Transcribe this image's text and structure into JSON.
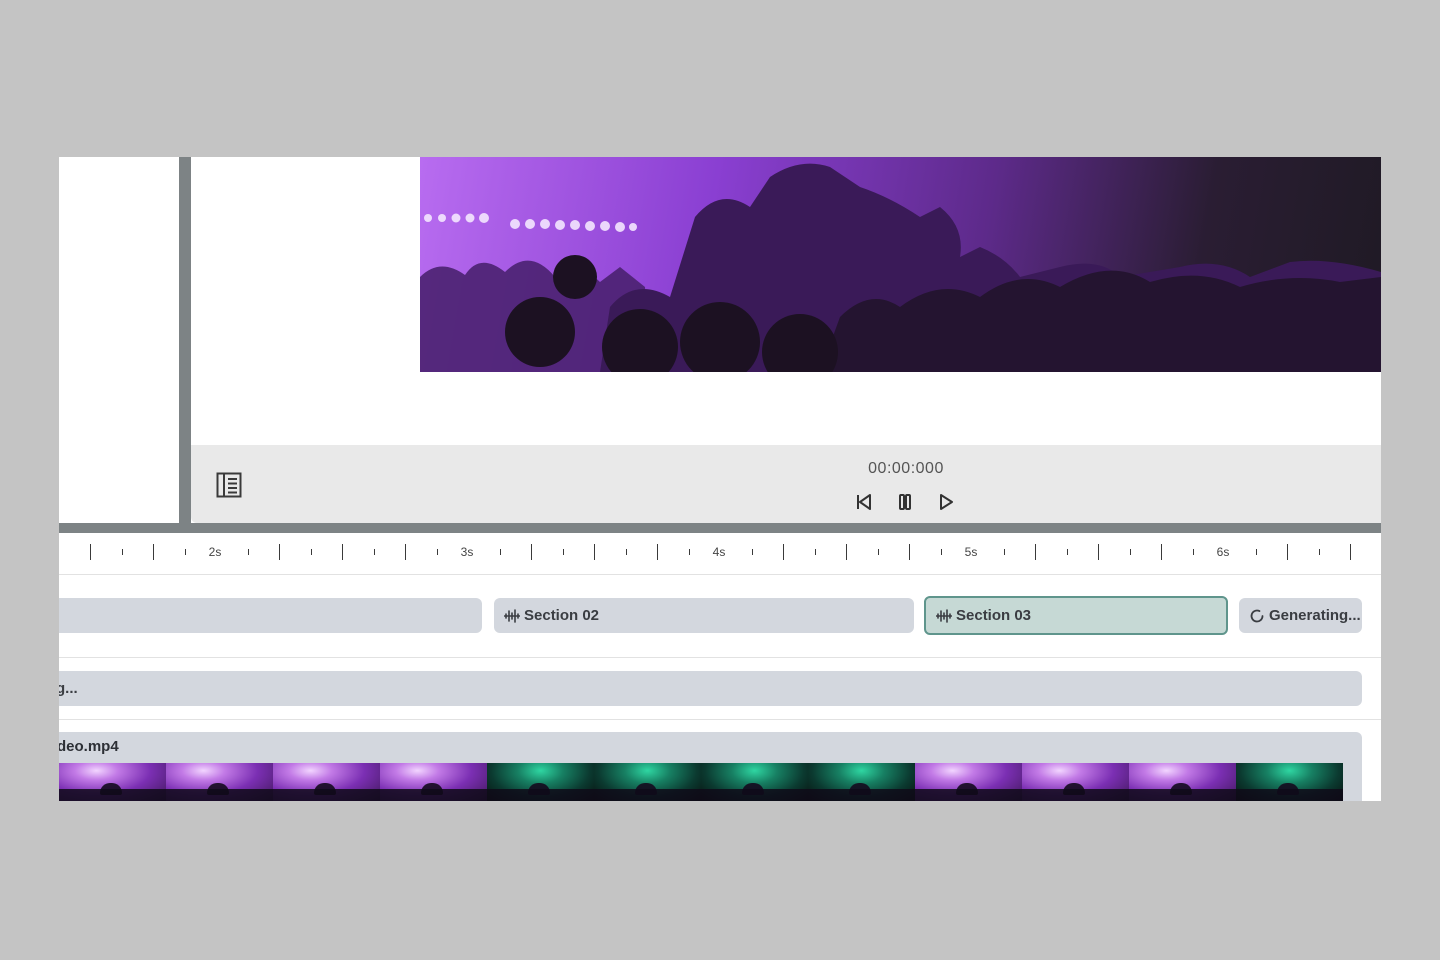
{
  "preview": {
    "timecode": "00:00:000"
  },
  "controls": {
    "toggle_icon": "panel-toggle-icon",
    "prev_icon": "skip-back-icon",
    "pause_icon": "pause-icon",
    "play_icon": "play-icon"
  },
  "ruler": {
    "labels": [
      "2s",
      "3s",
      "4s",
      "5s",
      "6s"
    ]
  },
  "tracks": {
    "sections": {
      "clips": [
        {
          "label": ""
        },
        {
          "label": "Section 02",
          "icon": "waveform-icon"
        },
        {
          "label": "Section 03",
          "icon": "waveform-icon",
          "selected": true
        },
        {
          "label": "Generating...",
          "icon": "loading-spinner-icon"
        }
      ]
    },
    "audio": {
      "label": "g..."
    },
    "video": {
      "filename": "deo.mp4",
      "frames": [
        "purple",
        "purple",
        "purple",
        "purple",
        "green",
        "green",
        "green",
        "green",
        "purple",
        "purple",
        "purple",
        "green"
      ]
    }
  },
  "colors": {
    "background": "#c4c4c4",
    "gutter": "#7d8385",
    "clip": "#d3d7de",
    "clip_selected": "#c6d9d5",
    "clip_selected_border": "#5f958c",
    "controls_bar": "#e9e9e9"
  }
}
